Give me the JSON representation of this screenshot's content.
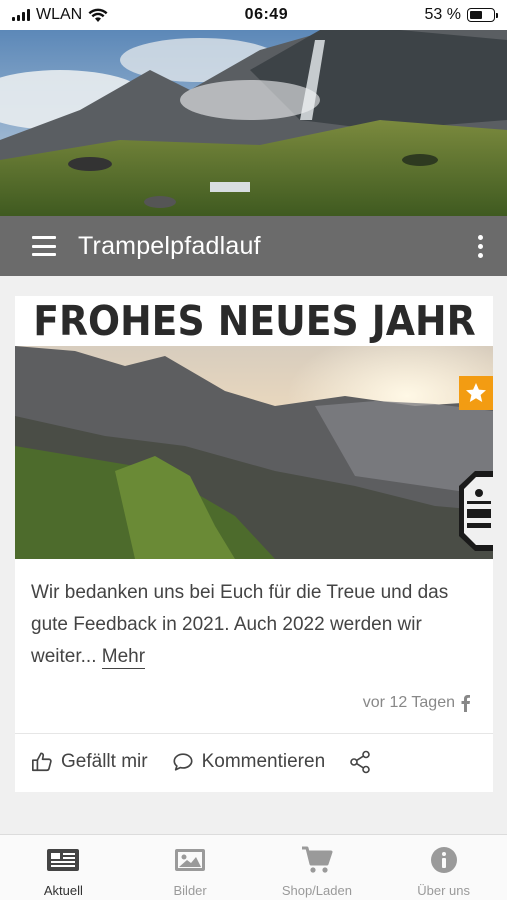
{
  "status_bar": {
    "carrier": "WLAN",
    "time": "06:49",
    "battery": "53 %",
    "battery_level": 0.53
  },
  "app_bar": {
    "title": "Trampelpfadlauf",
    "menu_icon": "hamburger-icon",
    "overflow_icon": "kebab-icon"
  },
  "post": {
    "banner_text": "FROHES NEUES JAHR",
    "badge_icon": "star-icon",
    "text": "Wir bedanken uns bei Euch für die Treue und das gute Feedback in 2021. Auch 2022 werden wir weiter...",
    "more_label": "Mehr",
    "timestamp": "vor 12 Tagen",
    "source_icon": "facebook-icon",
    "actions": {
      "like": "Gefällt mir",
      "comment": "Kommentieren",
      "share_icon": "share-icon"
    }
  },
  "tabs": [
    {
      "label": "Aktuell",
      "icon": "news-icon",
      "active": true
    },
    {
      "label": "Bilder",
      "icon": "image-icon",
      "active": false
    },
    {
      "label": "Shop/Laden",
      "icon": "cart-icon",
      "active": false
    },
    {
      "label": "Über uns",
      "icon": "info-icon",
      "active": false
    }
  ],
  "colors": {
    "app_bar": "#6b6b6b",
    "badge": "#f39c12",
    "background": "#f0f0f0"
  }
}
